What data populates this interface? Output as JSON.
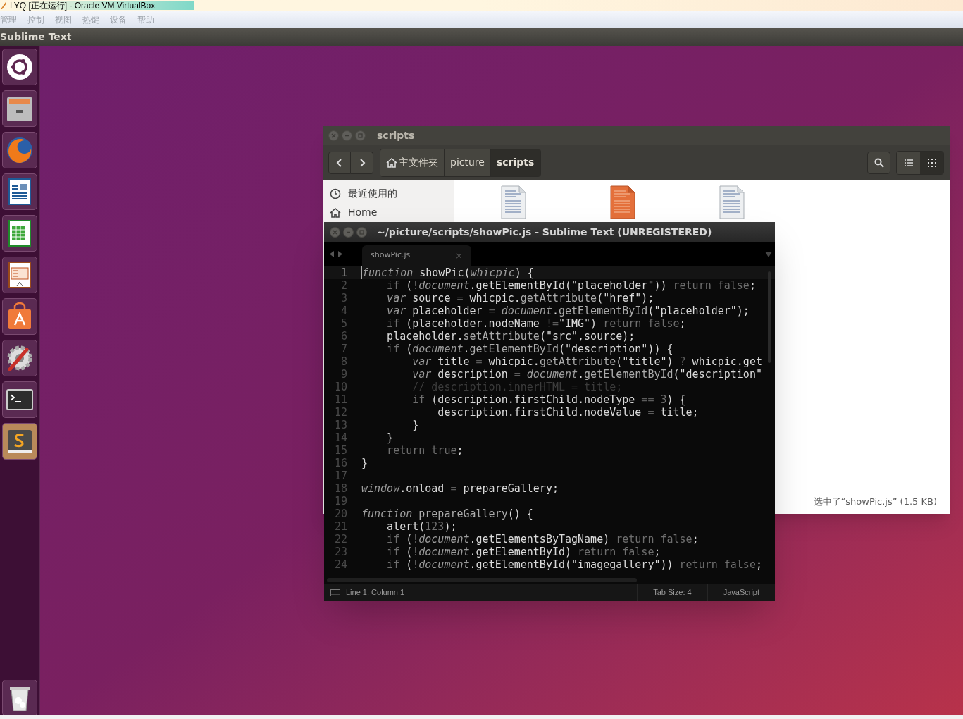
{
  "host_window": {
    "title": "LYQ [正在运行] - Oracle VM VirtualBox",
    "menu": [
      "管理",
      "控制",
      "视图",
      "热键",
      "设备",
      "帮助"
    ]
  },
  "top_panel": {
    "app_name": "Sublime Text"
  },
  "file_manager": {
    "title": "scripts",
    "breadcrumbs": [
      {
        "label": "主文件夹",
        "kind": "home",
        "selected": false
      },
      {
        "label": "picture",
        "kind": "folder",
        "selected": false
      },
      {
        "label": "scripts",
        "kind": "folder",
        "selected": true
      }
    ],
    "view_modes": [
      {
        "kind": "list",
        "selected": false
      },
      {
        "kind": "grid",
        "selected": true
      }
    ],
    "sidebar": [
      {
        "label": "最近使用的",
        "kind": "recent"
      },
      {
        "label": "Home",
        "kind": "home"
      }
    ],
    "files": [
      {
        "selected": false
      },
      {
        "selected": true
      },
      {
        "selected": false
      }
    ],
    "status": "选中了“showPic.js” (1.5 KB)"
  },
  "editor": {
    "title": "~/picture/scripts/showPic.js - Sublime Text (UNREGISTERED)",
    "tab": {
      "label": "showPic.js",
      "close": "×"
    },
    "lines": [
      {
        "number": "1",
        "current": true,
        "tokens": [
          {
            "text": "function",
            "kind": "it"
          },
          {
            "text": " showPic(",
            "kind": "pl"
          },
          {
            "text": "whicpic",
            "kind": "it"
          },
          {
            "text": ") {",
            "kind": "pl"
          }
        ]
      },
      {
        "number": "2",
        "current": false,
        "tokens": [
          {
            "text": "    if",
            "kind": "kw"
          },
          {
            "text": " (",
            "kind": "pl"
          },
          {
            "text": "!",
            "kind": "op"
          },
          {
            "text": "document",
            "kind": "it"
          },
          {
            "text": ".getElementById(\"placeholder\"))",
            "kind": "pl"
          },
          {
            "text": " return false",
            "kind": "kw"
          },
          {
            "text": ";",
            "kind": "pl"
          }
        ]
      },
      {
        "number": "3",
        "current": false,
        "tokens": [
          {
            "text": "    var",
            "kind": "it"
          },
          {
            "text": " source ",
            "kind": "pl"
          },
          {
            "text": "=",
            "kind": "op"
          },
          {
            "text": " whicpic.",
            "kind": "pl"
          },
          {
            "text": "getAttribute",
            "kind": "fn"
          },
          {
            "text": "(\"href\");",
            "kind": "pl"
          }
        ]
      },
      {
        "number": "4",
        "current": false,
        "tokens": [
          {
            "text": "    var",
            "kind": "it"
          },
          {
            "text": " placeholder ",
            "kind": "pl"
          },
          {
            "text": "=",
            "kind": "op"
          },
          {
            "text": " document",
            "kind": "it"
          },
          {
            "text": ".",
            "kind": "pl"
          },
          {
            "text": "getElementById",
            "kind": "fn"
          },
          {
            "text": "(\"placeholder\");",
            "kind": "pl"
          }
        ]
      },
      {
        "number": "5",
        "current": false,
        "tokens": [
          {
            "text": "    if",
            "kind": "kw"
          },
          {
            "text": " (placeholder.nodeName ",
            "kind": "pl"
          },
          {
            "text": "!=",
            "kind": "op"
          },
          {
            "text": "\"IMG\")",
            "kind": "pl"
          },
          {
            "text": " return false",
            "kind": "kw"
          },
          {
            "text": ";",
            "kind": "pl"
          }
        ]
      },
      {
        "number": "6",
        "current": false,
        "tokens": [
          {
            "text": "    placeholder.",
            "kind": "pl"
          },
          {
            "text": "setAttribute",
            "kind": "fn"
          },
          {
            "text": "(\"src\",source);",
            "kind": "pl"
          }
        ]
      },
      {
        "number": "7",
        "current": false,
        "tokens": [
          {
            "text": "    if",
            "kind": "kw"
          },
          {
            "text": " (",
            "kind": "pl"
          },
          {
            "text": "document",
            "kind": "it"
          },
          {
            "text": ".",
            "kind": "pl"
          },
          {
            "text": "getElementById",
            "kind": "fn"
          },
          {
            "text": "(\"description\")) {",
            "kind": "pl"
          }
        ]
      },
      {
        "number": "8",
        "current": false,
        "tokens": [
          {
            "text": "        var",
            "kind": "it"
          },
          {
            "text": " title ",
            "kind": "pl"
          },
          {
            "text": "=",
            "kind": "op"
          },
          {
            "text": " whicpic.",
            "kind": "pl"
          },
          {
            "text": "getAttribute",
            "kind": "fn"
          },
          {
            "text": "(\"title\") ",
            "kind": "pl"
          },
          {
            "text": "?",
            "kind": "op"
          },
          {
            "text": " whicpic.get",
            "kind": "pl"
          }
        ]
      },
      {
        "number": "9",
        "current": false,
        "tokens": [
          {
            "text": "        var",
            "kind": "it"
          },
          {
            "text": " description ",
            "kind": "pl"
          },
          {
            "text": "=",
            "kind": "op"
          },
          {
            "text": " document",
            "kind": "it"
          },
          {
            "text": ".",
            "kind": "pl"
          },
          {
            "text": "getElementById",
            "kind": "fn"
          },
          {
            "text": "(\"description\"",
            "kind": "pl"
          }
        ]
      },
      {
        "number": "10",
        "current": false,
        "tokens": [
          {
            "text": "        // description.innerHTML = title;",
            "kind": "cm"
          }
        ]
      },
      {
        "number": "11",
        "current": false,
        "tokens": [
          {
            "text": "        if",
            "kind": "kw"
          },
          {
            "text": " (description.firstChild.nodeType ",
            "kind": "pl"
          },
          {
            "text": "==",
            "kind": "op"
          },
          {
            "text": " 3",
            "kind": "nm"
          },
          {
            "text": ") {",
            "kind": "pl"
          }
        ]
      },
      {
        "number": "12",
        "current": false,
        "tokens": [
          {
            "text": "            description.firstChild.nodeValue ",
            "kind": "pl"
          },
          {
            "text": "=",
            "kind": "op"
          },
          {
            "text": " title;",
            "kind": "pl"
          }
        ]
      },
      {
        "number": "13",
        "current": false,
        "tokens": [
          {
            "text": "        }",
            "kind": "pl"
          }
        ]
      },
      {
        "number": "14",
        "current": false,
        "tokens": [
          {
            "text": "    }",
            "kind": "pl"
          }
        ]
      },
      {
        "number": "15",
        "current": false,
        "tokens": [
          {
            "text": "    return true",
            "kind": "kw"
          },
          {
            "text": ";",
            "kind": "pl"
          }
        ]
      },
      {
        "number": "16",
        "current": false,
        "tokens": [
          {
            "text": "}",
            "kind": "pl"
          }
        ]
      },
      {
        "number": "17",
        "current": false
      },
      {
        "number": "18",
        "current": false,
        "tokens": [
          {
            "text": "window",
            "kind": "it"
          },
          {
            "text": ".onload ",
            "kind": "pl"
          },
          {
            "text": "=",
            "kind": "op"
          },
          {
            "text": " prepareGallery;",
            "kind": "pl"
          }
        ]
      },
      {
        "number": "19",
        "current": false
      },
      {
        "number": "20",
        "current": false,
        "tokens": [
          {
            "text": "function",
            "kind": "it"
          },
          {
            "text": " prepareGallery",
            "kind": "fn"
          },
          {
            "text": "() {",
            "kind": "pl"
          }
        ]
      },
      {
        "number": "21",
        "current": false,
        "tokens": [
          {
            "text": "    alert(",
            "kind": "pl"
          },
          {
            "text": "123",
            "kind": "nm"
          },
          {
            "text": ");",
            "kind": "pl"
          }
        ]
      },
      {
        "number": "22",
        "current": false,
        "tokens": [
          {
            "text": "    if",
            "kind": "kw"
          },
          {
            "text": " (",
            "kind": "pl"
          },
          {
            "text": "!",
            "kind": "op"
          },
          {
            "text": "document",
            "kind": "it"
          },
          {
            "text": ".getElementsByTagName)",
            "kind": "pl"
          },
          {
            "text": " return false",
            "kind": "kw"
          },
          {
            "text": ";",
            "kind": "pl"
          }
        ]
      },
      {
        "number": "23",
        "current": false,
        "tokens": [
          {
            "text": "    if",
            "kind": "kw"
          },
          {
            "text": " (",
            "kind": "pl"
          },
          {
            "text": "!",
            "kind": "op"
          },
          {
            "text": "document",
            "kind": "it"
          },
          {
            "text": ".getElementById)",
            "kind": "pl"
          },
          {
            "text": " return false",
            "kind": "kw"
          },
          {
            "text": ";",
            "kind": "pl"
          }
        ]
      },
      {
        "number": "24",
        "current": false,
        "tokens": [
          {
            "text": "    if",
            "kind": "kw"
          },
          {
            "text": " (",
            "kind": "pl"
          },
          {
            "text": "!",
            "kind": "op"
          },
          {
            "text": "document",
            "kind": "it"
          },
          {
            "text": ".getElementById(\"imagegallery\"))",
            "kind": "pl"
          },
          {
            "text": " return false",
            "kind": "kw"
          },
          {
            "text": ";",
            "kind": "pl"
          }
        ]
      }
    ],
    "status_bar": {
      "position": "Line 1, Column 1",
      "tab_size": "Tab Size: 4",
      "syntax": "JavaScript"
    }
  }
}
